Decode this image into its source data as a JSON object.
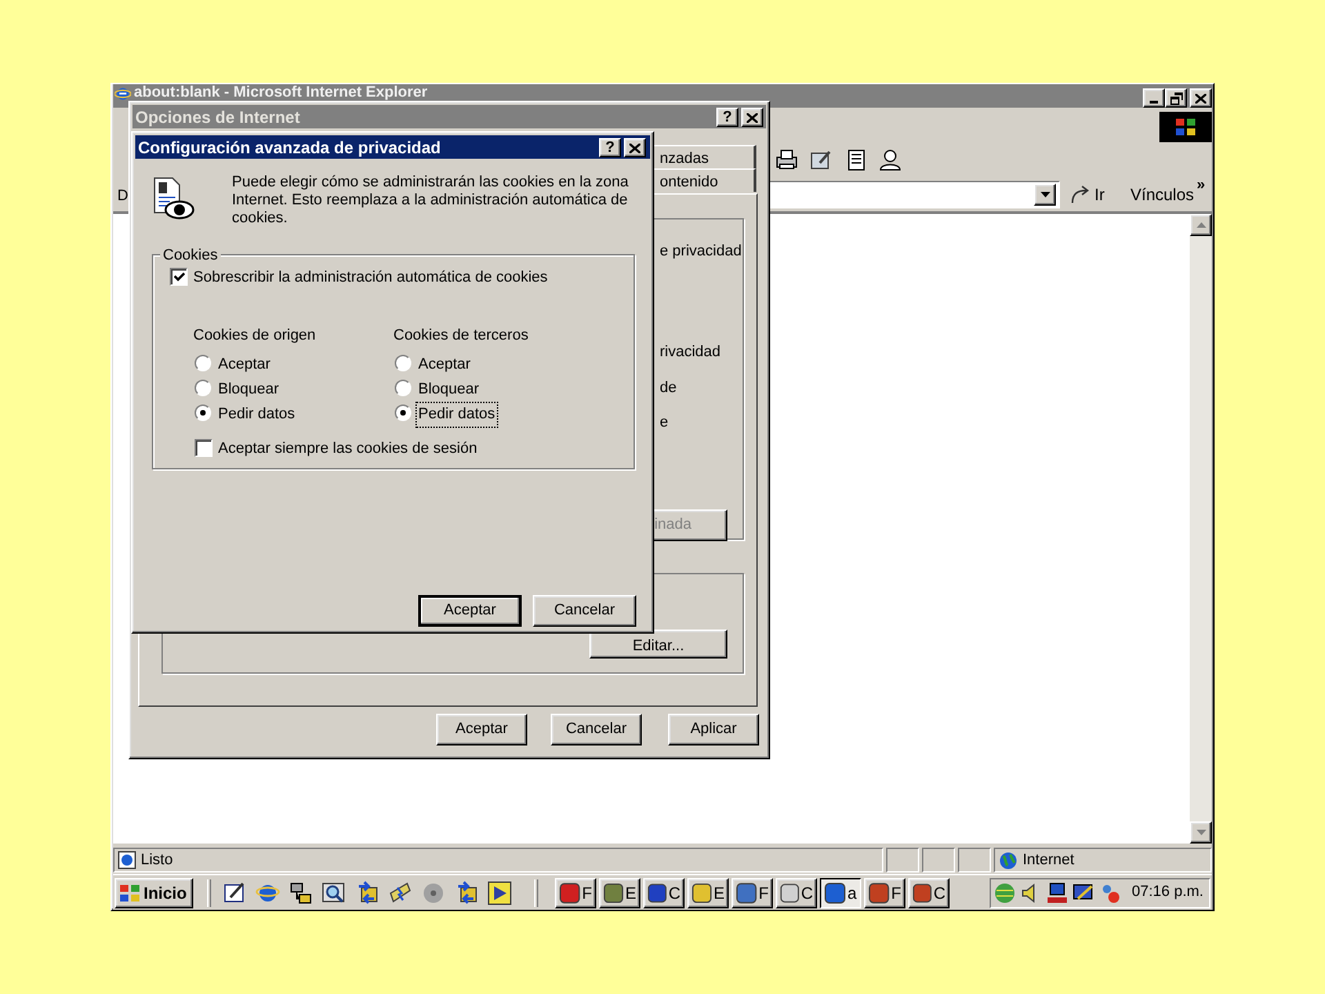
{
  "browser": {
    "title": "about:blank - Microsoft Internet Explorer",
    "address_label": "D",
    "go_button": "Ir",
    "links_button": "Vínculos",
    "links_more": "»",
    "status": "Listo",
    "zone": "Internet"
  },
  "internet_options": {
    "title": "Opciones de Internet",
    "help_button": "?",
    "tabs": [
      {
        "label": "nzadas",
        "selected": false
      },
      {
        "label": "ontenido",
        "selected": false
      }
    ],
    "privacy_texts": [
      "e privacidad",
      "rivacidad",
      "de",
      "e"
    ],
    "privacy_button": {
      "label": "inada",
      "disabled": true
    },
    "edit_button": {
      "label": "Editar...",
      "disabled": false
    },
    "buttons": [
      {
        "label": "Aceptar",
        "default": false
      },
      {
        "label": "Cancelar",
        "default": false
      },
      {
        "label": "Aplicar",
        "default": false
      }
    ]
  },
  "privacy_dialog": {
    "title": "Configuración avanzada de privacidad",
    "help_button": "?",
    "description": "Puede elegir cómo se administrarán las cookies en la zona Internet. Esto reemplaza a la administración automática de cookies.",
    "group": "Cookies",
    "override": {
      "label": "Sobrescribir la administración automática de cookies",
      "checked": true
    },
    "columns": [
      {
        "heading": "Cookies de origen",
        "options": [
          {
            "label": "Aceptar",
            "selected": false,
            "focused": false
          },
          {
            "label": "Bloquear",
            "selected": false,
            "focused": false
          },
          {
            "label": "Pedir datos",
            "selected": true,
            "focused": false
          }
        ]
      },
      {
        "heading": "Cookies de terceros",
        "options": [
          {
            "label": "Aceptar",
            "selected": false,
            "focused": false
          },
          {
            "label": "Bloquear",
            "selected": false,
            "focused": false
          },
          {
            "label": "Pedir datos",
            "selected": true,
            "focused": true
          }
        ]
      }
    ],
    "session": {
      "label": "Aceptar siempre las cookies de sesión",
      "checked": false
    },
    "buttons": [
      {
        "label": "Aceptar",
        "default": true
      },
      {
        "label": "Cancelar",
        "default": false
      }
    ]
  },
  "taskbar": {
    "start": "Inicio",
    "tasks": [
      {
        "label": "F",
        "pressed": false
      },
      {
        "label": "E",
        "pressed": false
      },
      {
        "label": "C",
        "pressed": false
      },
      {
        "label": "E",
        "pressed": false
      },
      {
        "label": "F",
        "pressed": false
      },
      {
        "label": "C",
        "pressed": false
      },
      {
        "label": "a",
        "pressed": true
      },
      {
        "label": "F",
        "pressed": false
      },
      {
        "label": "C",
        "pressed": false
      }
    ],
    "clock": "07:16 p.m."
  }
}
